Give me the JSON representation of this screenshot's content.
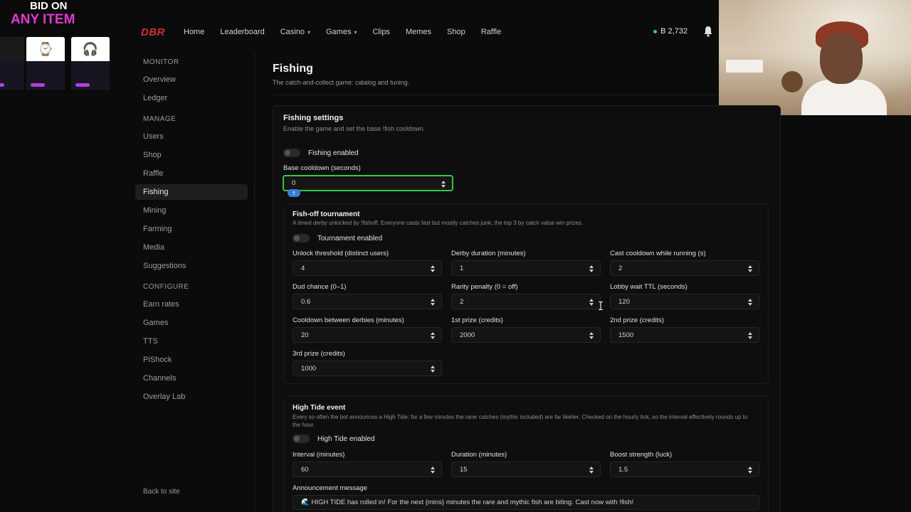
{
  "ad": {
    "line1": "BID ON",
    "line2": "ANY ITEM",
    "cards": [
      {
        "icon": "watch-icon"
      },
      {
        "icon": "headphones-icon"
      },
      {
        "icon": "headset-icon"
      }
    ]
  },
  "nav": {
    "logo": "DBR",
    "links": [
      {
        "label": "Home"
      },
      {
        "label": "Leaderboard"
      },
      {
        "label": "Casino",
        "dropdown": true
      },
      {
        "label": "Games",
        "dropdown": true
      },
      {
        "label": "Clips"
      },
      {
        "label": "Memes"
      },
      {
        "label": "Shop"
      },
      {
        "label": "Raffle"
      }
    ],
    "balance": "B 2,732"
  },
  "sidebar": {
    "sections": [
      {
        "title": "MONITOR",
        "items": [
          "Overview",
          "Ledger"
        ]
      },
      {
        "title": "MANAGE",
        "items": [
          "Users",
          "Shop",
          "Raffle",
          "Fishing",
          "Mining",
          "Farming",
          "Media",
          "Suggestions"
        ]
      },
      {
        "title": "CONFIGURE",
        "items": [
          "Earn rates",
          "Games",
          "TTS",
          "PiShock",
          "Channels",
          "Overlay Lab"
        ]
      }
    ],
    "active": "Fishing",
    "back": "Back to site"
  },
  "page": {
    "title": "Fishing",
    "subtitle": "The catch-and-collect game: catalog and tuning."
  },
  "settings": {
    "title": "Fishing settings",
    "subtitle": "Enable the game and set the base !fish cooldown.",
    "enabled_label": "Fishing enabled",
    "cooldown_label": "Base cooldown (seconds)",
    "cooldown_value": "0"
  },
  "tournament": {
    "title": "Fish-off tournament",
    "subtitle": "A timed derby unlocked by !fishoff. Everyone casts fast but mostly catches junk; the top 3 by catch value win prizes.",
    "enabled_label": "Tournament enabled",
    "fields": [
      {
        "label": "Unlock threshold (distinct users)",
        "value": "4"
      },
      {
        "label": "Derby duration (minutes)",
        "value": "1"
      },
      {
        "label": "Cast cooldown while running (s)",
        "value": "2"
      },
      {
        "label": "Dud chance (0–1)",
        "value": "0.6"
      },
      {
        "label": "Rarity penalty (0 = off)",
        "value": "2"
      },
      {
        "label": "Lobby wait TTL (seconds)",
        "value": "120"
      },
      {
        "label": "Cooldown between derbies (minutes)",
        "value": "20"
      },
      {
        "label": "1st prize (credits)",
        "value": "2000"
      },
      {
        "label": "2nd prize (credits)",
        "value": "1500"
      },
      {
        "label": "3rd prize (credits)",
        "value": "1000"
      }
    ]
  },
  "high_tide": {
    "title": "High Tide event",
    "subtitle": "Every so often the bot announces a High Tide: for a few minutes the rarer catches (mythic included) are far likelier. Checked on the hourly tick, so the interval effectively rounds up to the hour.",
    "enabled_label": "High Tide enabled",
    "fields": [
      {
        "label": "Interval (minutes)",
        "value": "60"
      },
      {
        "label": "Duration (minutes)",
        "value": "15"
      },
      {
        "label": "Boost strength (luck)",
        "value": "1.5"
      }
    ],
    "message_label": "Announcement message",
    "message_value": "🌊 HIGH TIDE has rolled in! For the next {mins} minutes the rare and mythic fish are biting. Cast now with !fish!"
  },
  "colors": {
    "accent_green": "#3cc24a",
    "logo_red": "#d0312d",
    "ad_pink": "#e03ad3",
    "badge_blue": "#3a7bd5"
  }
}
